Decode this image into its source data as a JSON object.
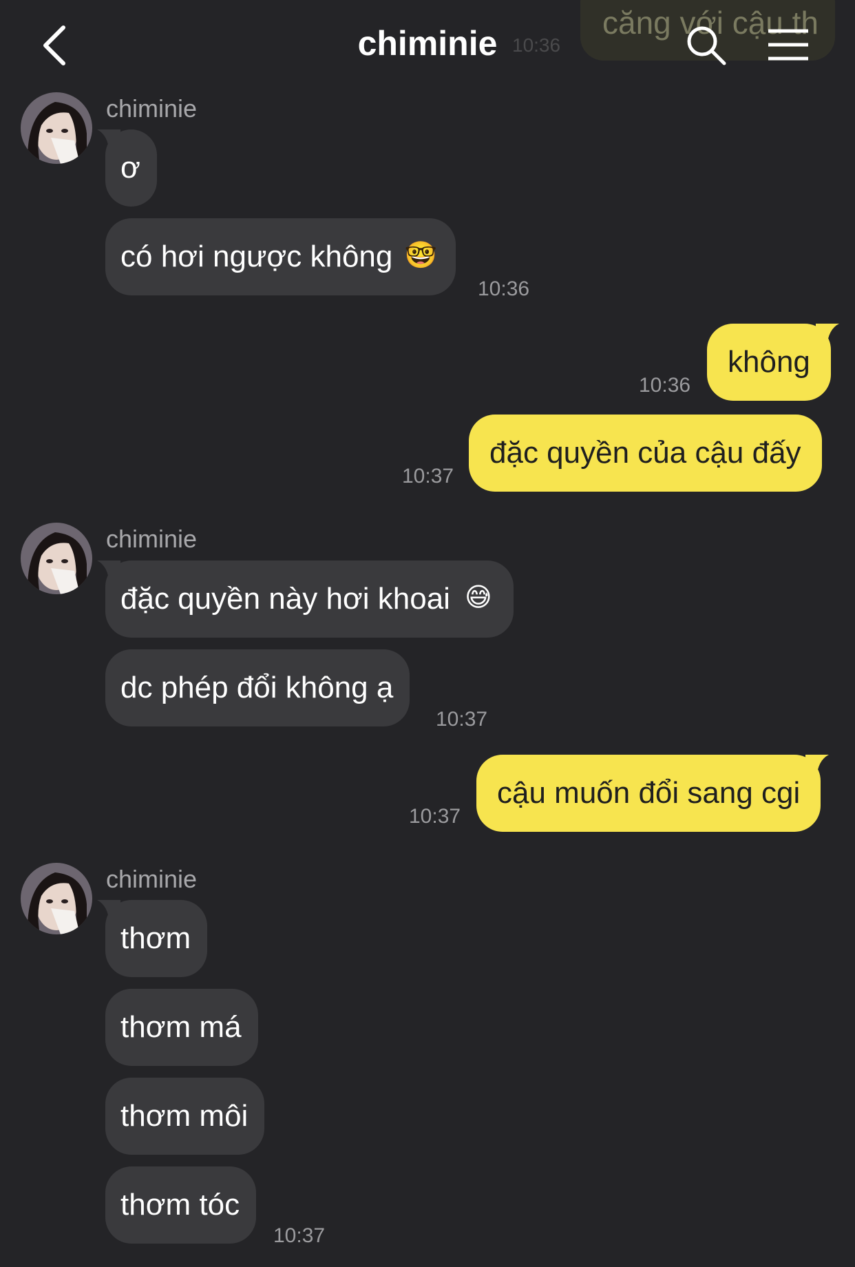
{
  "header": {
    "title": "chiminie",
    "ghost_text": "căng với cậu th",
    "ghost_time": "10:36"
  },
  "messages": {
    "g1": {
      "sender": "chiminie",
      "m1": "ơ",
      "m2": "có hơi ngược không",
      "m2_emoji": "🤓",
      "time": "10:36"
    },
    "o1": {
      "text": "không",
      "time": "10:36"
    },
    "o2": {
      "text": "đặc quyền của cậu đấy",
      "time": "10:37"
    },
    "g2": {
      "sender": "chiminie",
      "m1": "đặc quyền này hơi khoai",
      "m1_emoji": "😅",
      "m2": "dc phép đổi không ạ",
      "time": "10:37"
    },
    "o3": {
      "text": "cậu muốn đổi sang cgi",
      "time": "10:37"
    },
    "g3": {
      "sender": "chiminie",
      "m1": "thơm",
      "m2": "thơm má",
      "m3": "thơm môi",
      "m4": "thơm tóc",
      "time": "10:37"
    }
  },
  "colors": {
    "background": "#242427",
    "incoming_bubble": "#3a3a3d",
    "outgoing_bubble": "#f7e44f"
  }
}
